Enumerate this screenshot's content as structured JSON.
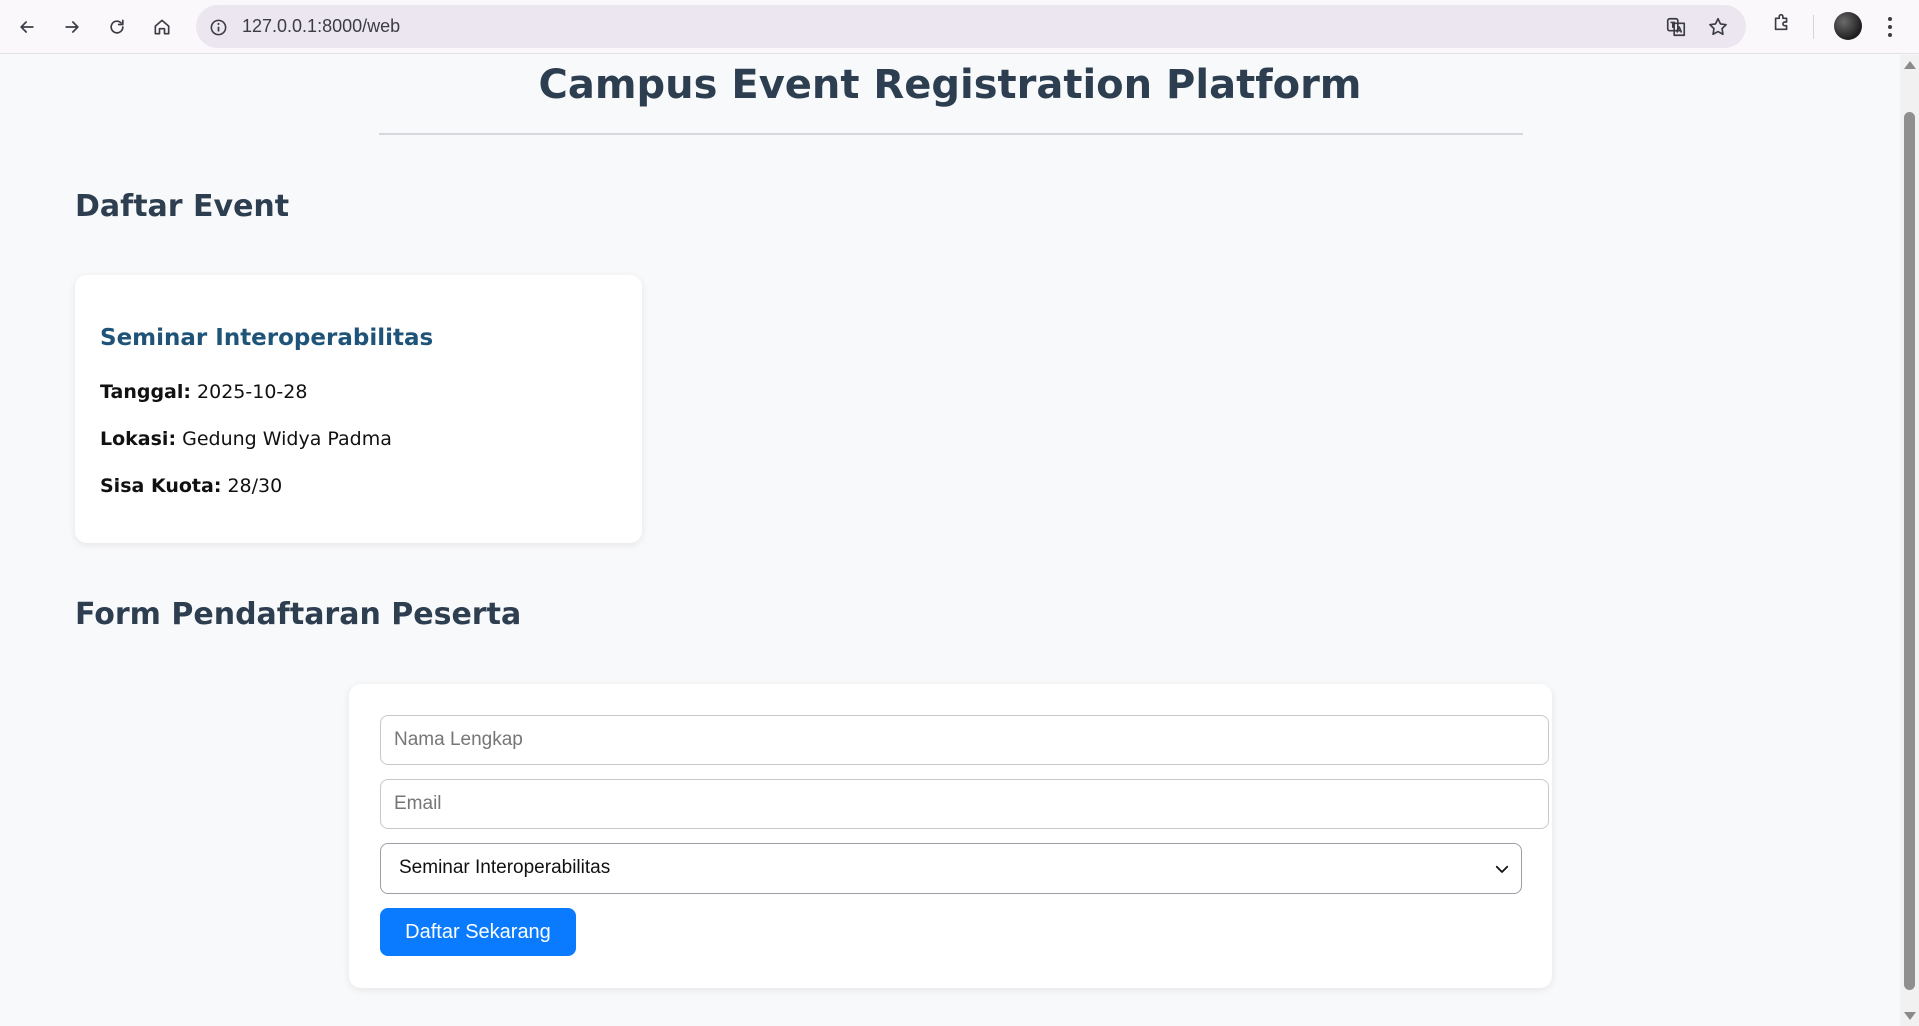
{
  "browser": {
    "url": "127.0.0.1:8000/web",
    "icons": {
      "back": "arrow-left-icon",
      "forward": "arrow-right-icon",
      "reload": "reload-icon",
      "home": "home-icon",
      "site_info": "info-icon",
      "translate": "translate-icon",
      "bookmark": "star-icon",
      "extensions": "puzzle-icon",
      "profile": "avatar",
      "menu": "kebab-menu-icon"
    }
  },
  "page": {
    "title": "Campus Event Registration Platform",
    "events_heading": "Daftar Event",
    "events": [
      {
        "name": "Seminar Interoperabilitas",
        "date_label": "Tanggal:",
        "date": "2025-10-28",
        "location_label": "Lokasi:",
        "location": "Gedung Widya Padma",
        "quota_label": "Sisa Kuota:",
        "quota": "28/30"
      }
    ],
    "form_heading": "Form Pendaftaran Peserta",
    "form": {
      "name_placeholder": "Nama Lengkap",
      "name_value": "",
      "email_placeholder": "Email",
      "email_value": "",
      "event_select_value": "Seminar Interoperabilitas",
      "submit_label": "Daftar Sekarang"
    }
  },
  "colors": {
    "accent": "#0a7bff",
    "heading": "#2c3e50",
    "event_title": "#1f5478",
    "page_bg": "#f8f9fa"
  }
}
